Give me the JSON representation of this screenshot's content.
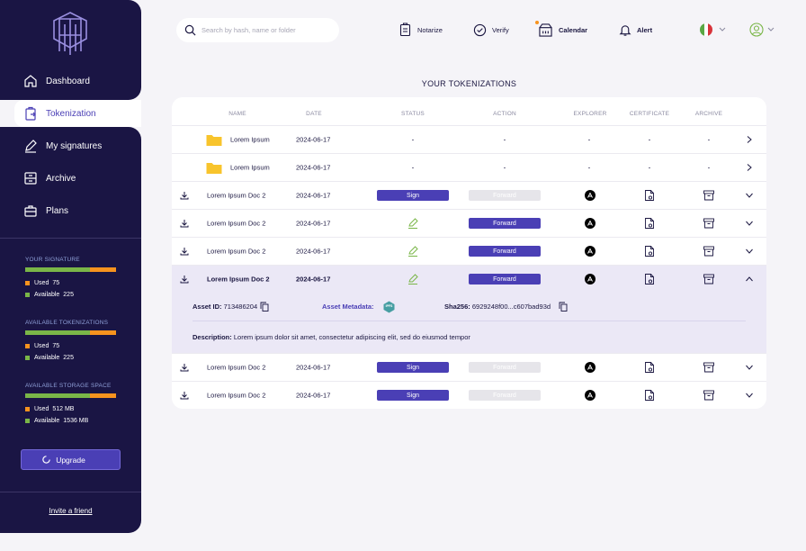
{
  "sidebar": {
    "nav": [
      {
        "label": "Dashboard"
      },
      {
        "label": "Tokenization"
      },
      {
        "label": "My signatures"
      },
      {
        "label": "Archive"
      },
      {
        "label": "Plans"
      }
    ],
    "stats": [
      {
        "title": "YOUR SIGNATURE",
        "used_label": "Used",
        "used": "75",
        "avail_label": "Available",
        "available": "225",
        "used_fraction": 0.29
      },
      {
        "title": "AVAILABLE TOKENIZATIONS",
        "used_label": "Used",
        "used": "75",
        "avail_label": "Available",
        "available": "225",
        "used_fraction": 0.29
      },
      {
        "title": "AVAILABLE STORAGE SPACE",
        "used_label": "Used",
        "used": "512 MB",
        "avail_label": "Available",
        "available": "1536 MB",
        "used_fraction": 0.29
      }
    ],
    "upgrade_label": "Upgrade",
    "invite_label": "Invite a friend"
  },
  "topbar": {
    "search_placeholder": "Search by hash, name or folder",
    "notarize": "Notarize",
    "verify": "Verify",
    "calendar": "Calendar",
    "alert": "Alert"
  },
  "main": {
    "title": "YOUR TOKENIZATIONS",
    "columns": [
      "NAME",
      "DATE",
      "STATUS",
      "ACTION",
      "EXPLORER",
      "CERTIFICATE",
      "ARCHIVE"
    ],
    "rows": [
      {
        "type": "folder",
        "name": "Lorem Ipsum",
        "date": "2024-06-17",
        "status": "-",
        "action": "-",
        "explorer": "-",
        "certificate": "-",
        "archive": "-"
      },
      {
        "type": "folder",
        "name": "Lorem Ipsum",
        "date": "2024-06-17",
        "status": "-",
        "action": "-",
        "explorer": "-",
        "certificate": "-",
        "archive": "-"
      },
      {
        "type": "doc",
        "name": "Lorem Ipsum Doc 2",
        "date": "2024-06-17",
        "status": "Sign",
        "action": "Forward",
        "action_enabled": false
      },
      {
        "type": "doc",
        "name": "Lorem Ipsum Doc 2",
        "date": "2024-06-17",
        "status": "signed",
        "action": "Forward",
        "action_enabled": true
      },
      {
        "type": "doc",
        "name": "Lorem Ipsum Doc 2",
        "date": "2024-06-17",
        "status": "signed",
        "action": "Forward",
        "action_enabled": true
      },
      {
        "type": "doc",
        "name": "Lorem Ipsum Doc 2",
        "date": "2024-06-17",
        "status": "signed",
        "action": "Forward",
        "action_enabled": true,
        "expanded": true
      },
      {
        "type": "doc",
        "name": "Lorem Ipsum Doc 2",
        "date": "2024-06-17",
        "status": "Sign",
        "action": "Forward",
        "action_enabled": false
      },
      {
        "type": "doc",
        "name": "Lorem Ipsum Doc 2",
        "date": "2024-06-17",
        "status": "Sign",
        "action": "Forward",
        "action_enabled": false
      }
    ],
    "details": {
      "asset_id_label": "Asset ID:",
      "asset_id": "713486204",
      "metadata_label": "Asset Metadata:",
      "ipfs_badge": "IPFS",
      "sha_label": "Sha256:",
      "sha": "6929248f00...c607bad93d",
      "description_label": "Description:",
      "description": "Lorem ipsum dolor sit amet, consectetur adipiscing elit, sed do eiusmod tempor"
    }
  },
  "colors": {
    "navy": "#1a1544",
    "accent": "#4a3fb5",
    "used": "#f7931e",
    "available": "#7ab648",
    "folder": "#f8c42c"
  }
}
